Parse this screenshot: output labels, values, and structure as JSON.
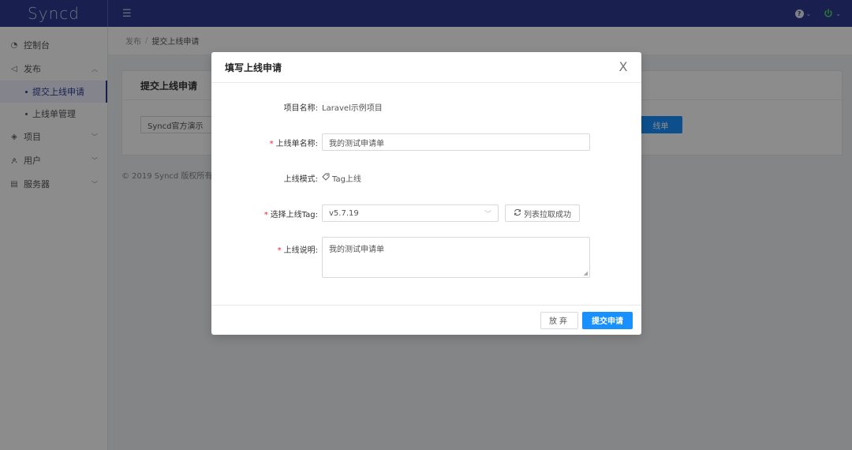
{
  "app": {
    "logo": "Syncd",
    "menu_toggle_icon": "menu-fold-icon"
  },
  "header": {
    "help_icon": "question-circle-icon",
    "power_icon": "power-icon"
  },
  "sidebar": {
    "items": [
      {
        "label": "控制台",
        "icon": "dashboard-icon"
      },
      {
        "label": "发布",
        "icon": "send-icon",
        "expanded": true
      },
      {
        "label": "项目",
        "icon": "layers-icon"
      },
      {
        "label": "用户",
        "icon": "user-icon"
      },
      {
        "label": "服务器",
        "icon": "server-icon"
      }
    ],
    "sub_items": [
      {
        "label": "提交上线申请",
        "active": true
      },
      {
        "label": "上线单管理",
        "active": false
      }
    ]
  },
  "breadcrumb": {
    "parent": "发布",
    "separator": "/",
    "current": "提交上线申请"
  },
  "card": {
    "title": "提交上线申请",
    "select_value": "Syncd官方演示",
    "button_label": "线单"
  },
  "footer": {
    "text": "© 2019 Syncd 版权所有,"
  },
  "modal": {
    "title": "填写上线申请",
    "close": "X",
    "project_label": "项目名称:",
    "project_value": "Laravel示例项目",
    "name_label": "上线单名称:",
    "name_value": "我的测试申请单",
    "mode_label": "上线模式:",
    "mode_value": "Tag上线",
    "tag_label": "选择上线Tag:",
    "tag_value": "v5.7.19",
    "refresh_label": "列表拉取成功",
    "desc_label": "上线说明:",
    "desc_value": "我的测试申请单",
    "cancel_label": "放弃",
    "submit_label": "提交申请"
  },
  "colors": {
    "header_bg": "#2f3b93",
    "primary": "#1890ff",
    "required": "#f5222d"
  }
}
